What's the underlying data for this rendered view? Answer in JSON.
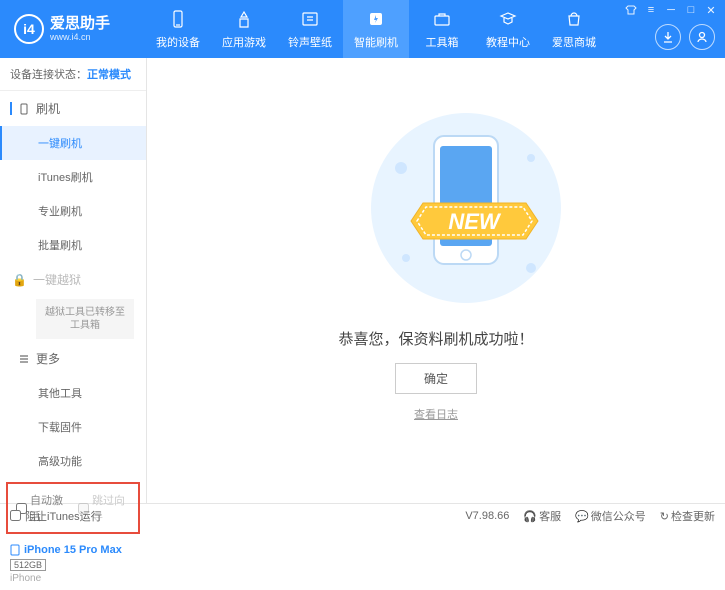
{
  "brand": {
    "name": "爱思助手",
    "url": "www.i4.cn"
  },
  "nav": [
    {
      "label": "我的设备"
    },
    {
      "label": "应用游戏"
    },
    {
      "label": "铃声壁纸"
    },
    {
      "label": "智能刷机"
    },
    {
      "label": "工具箱"
    },
    {
      "label": "教程中心"
    },
    {
      "label": "爱思商城"
    }
  ],
  "status": {
    "label": "设备连接状态：",
    "value": "正常模式"
  },
  "sidebar": {
    "flash": "刷机",
    "items": {
      "one_key": "一键刷机",
      "itunes": "iTunes刷机",
      "pro": "专业刷机",
      "batch": "批量刷机"
    },
    "jailbreak": "一键越狱",
    "jailbreak_note": "越狱工具已转移至工具箱",
    "more": "更多",
    "more_items": {
      "other_tools": "其他工具",
      "download_fw": "下载固件",
      "advanced": "高级功能"
    }
  },
  "checkboxes": {
    "auto_activate": "自动激活",
    "skip_guide": "跳过向导"
  },
  "device": {
    "name": "iPhone 15 Pro Max",
    "storage": "512GB",
    "type": "iPhone"
  },
  "main": {
    "success_text": "恭喜您，保资料刷机成功啦！",
    "ok": "确定",
    "view_log": "查看日志",
    "new_badge": "NEW"
  },
  "footer": {
    "block_itunes": "阻止iTunes运行",
    "version": "V7.98.66",
    "support": "客服",
    "wechat": "微信公众号",
    "check_update": "检查更新"
  }
}
